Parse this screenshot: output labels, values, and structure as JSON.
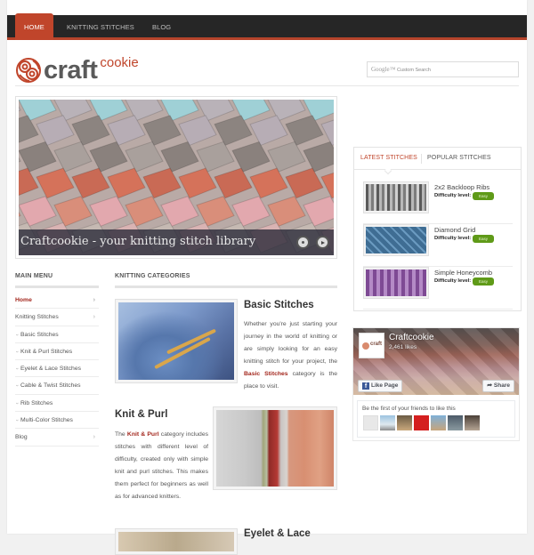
{
  "nav": {
    "items": [
      {
        "label": "HOME",
        "active": true
      },
      {
        "label": "KNITTING STITCHES",
        "active": false
      },
      {
        "label": "BLOG",
        "active": false
      }
    ]
  },
  "logo": {
    "part1": "craft",
    "part2": "cookie"
  },
  "search": {
    "brand": "Google™",
    "placeholder": "Custom Search"
  },
  "slider": {
    "caption": "Craftcookie - your knitting stitch library",
    "prev_label": "previous-slide",
    "next_label": "next-slide"
  },
  "main_menu": {
    "title": "MAIN MENU",
    "items": [
      {
        "label": "Home",
        "active": true,
        "sub": false,
        "chevron": "›"
      },
      {
        "label": "Knitting Stitches",
        "active": false,
        "sub": false,
        "chevron": "›"
      },
      {
        "label": "Basic Stitches",
        "active": false,
        "sub": true
      },
      {
        "label": "Knit & Purl Stitches",
        "active": false,
        "sub": true
      },
      {
        "label": "Eyelet & Lace Stitches",
        "active": false,
        "sub": true
      },
      {
        "label": "Cable & Twist Stitches",
        "active": false,
        "sub": true
      },
      {
        "label": "Rib Stitches",
        "active": false,
        "sub": true
      },
      {
        "label": "Multi-Color Stitches",
        "active": false,
        "sub": true
      },
      {
        "label": "Blog",
        "active": false,
        "sub": false,
        "chevron": "›"
      }
    ]
  },
  "categories": {
    "title": "KNITTING CATEGORIES",
    "items": [
      {
        "title": "Basic Stitches",
        "desc_before": "Whether you're just starting your journey in the world of knitting or are simply looking for an easy knitting stitch for your project, the ",
        "link": "Basic Stitches",
        "desc_after": " category is the place to visit."
      },
      {
        "title": "Knit & Purl",
        "desc_before": "The ",
        "link": "Knit & Purl",
        "desc_after": " category includes stitches with different level of difficulty, created only with simple knit and purl stitches. This makes them perfect for beginners as well as for advanced knitters."
      },
      {
        "title": "Eyelet & Lace"
      }
    ]
  },
  "stitch_tabs": {
    "tabs": [
      {
        "label": "LATEST STITCHES",
        "active": true
      },
      {
        "label": "POPULAR STITCHES",
        "active": false
      }
    ],
    "difficulty_label": "Difficulty level:",
    "items": [
      {
        "name": "2x2 Backloop Ribs",
        "difficulty": "Easy"
      },
      {
        "name": "Diamond Grid",
        "difficulty": "Easy"
      },
      {
        "name": "Simple Honeycomb",
        "difficulty": "Easy"
      }
    ]
  },
  "facebook": {
    "page_name": "Craftcookie",
    "likes": "2,461 likes",
    "like_button": "Like Page",
    "share_button": "Share",
    "friends_text": "Be the first of your friends to like this",
    "logo_text": "craft"
  },
  "colors": {
    "accent": "#c0452b",
    "link": "#a3271d",
    "nav_bg": "#262626",
    "badge": "#5f9a18"
  }
}
